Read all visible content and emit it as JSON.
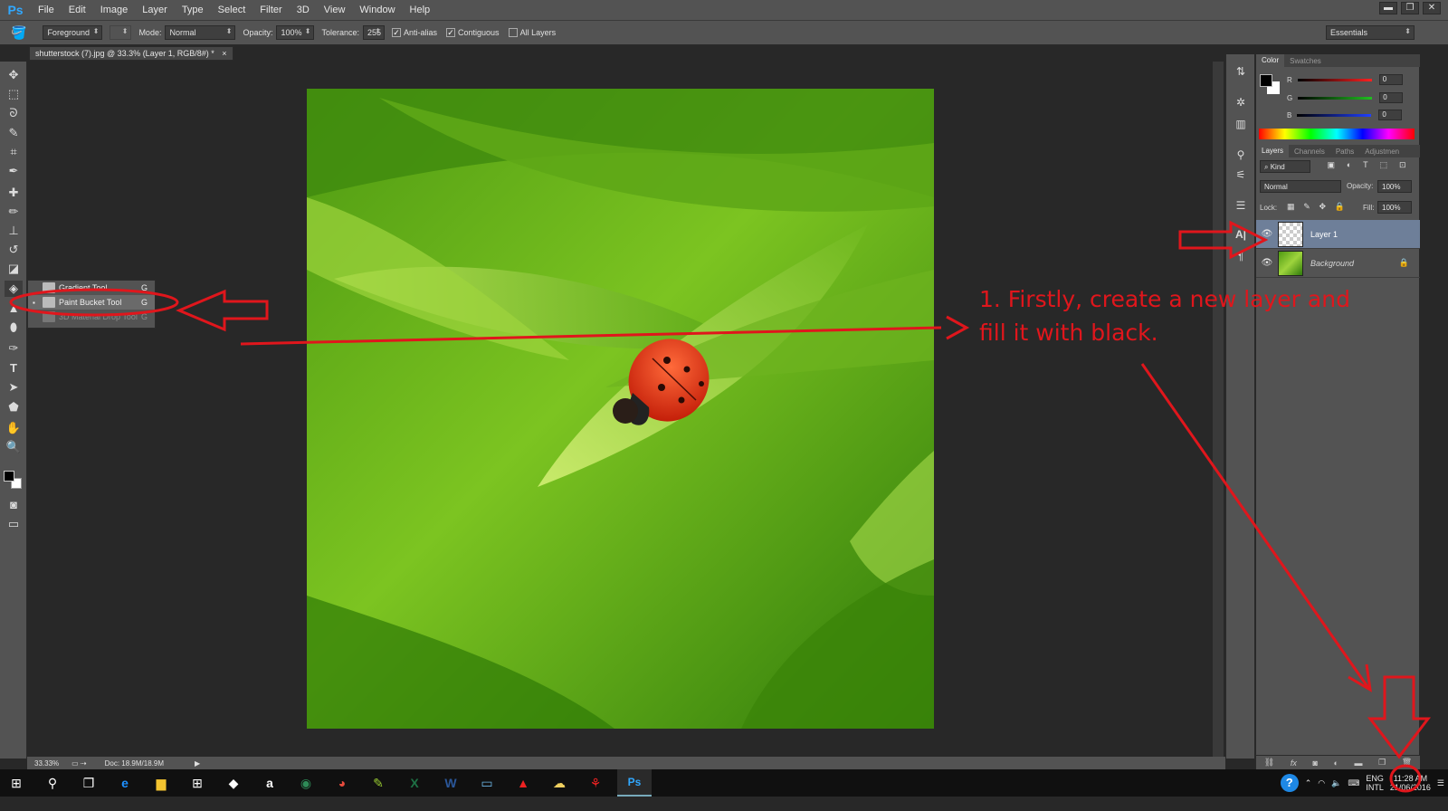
{
  "app": {
    "logo": "Ps"
  },
  "menu": [
    "File",
    "Edit",
    "Image",
    "Layer",
    "Type",
    "Select",
    "Filter",
    "3D",
    "View",
    "Window",
    "Help"
  ],
  "window_controls": [
    "▬",
    "❐",
    "✕"
  ],
  "options_bar": {
    "fill_source": "Foreground",
    "mode_label": "Mode:",
    "mode_value": "Normal",
    "opacity_label": "Opacity:",
    "opacity_value": "100%",
    "tolerance_label": "Tolerance:",
    "tolerance_value": "255",
    "antialias_label": "Anti-alias",
    "contiguous_label": "Contiguous",
    "all_layers_label": "All Layers",
    "workspace": "Essentials"
  },
  "document_tab": {
    "title": "shutterstock (7).jpg @ 33.3% (Layer 1, RGB/8#) *",
    "close": "×"
  },
  "tool_flyout": {
    "items": [
      {
        "label": "Gradient Tool",
        "key": "G"
      },
      {
        "label": "Paint Bucket Tool",
        "key": "G"
      },
      {
        "label": "3D Material Drop Tool",
        "key": "G"
      }
    ]
  },
  "color_panel": {
    "tabs": [
      "Color",
      "Swatches"
    ],
    "channels": [
      {
        "label": "R",
        "value": "0",
        "color": "#ff2020"
      },
      {
        "label": "G",
        "value": "0",
        "color": "#20c020"
      },
      {
        "label": "B",
        "value": "0",
        "color": "#2040ff"
      }
    ]
  },
  "layers_panel": {
    "tabs": [
      "Layers",
      "Channels",
      "Paths",
      "Adjustmen"
    ],
    "filter_label": "Kind",
    "blend_mode": "Normal",
    "opacity_label": "Opacity:",
    "opacity_value": "100%",
    "lock_label": "Lock:",
    "fill_label": "Fill:",
    "fill_value": "100%",
    "layers": [
      {
        "name": "Layer 1",
        "selected": true
      },
      {
        "name": "Background",
        "selected": false
      }
    ],
    "bottom_icons": [
      "link-icon",
      "fx-icon",
      "mask-icon",
      "adjustment-icon",
      "group-icon",
      "new-layer-icon",
      "trash-icon"
    ]
  },
  "status_bar": {
    "zoom": "33.33%",
    "doc": "Doc: 18.9M/18.9M"
  },
  "annotation": {
    "text": "1. Firstly, create a new layer and fill it with black.",
    "color": "#e0161c"
  },
  "taskbar": {
    "tray": {
      "lang": "ENG",
      "lang_sub": "INTL",
      "time": "11:28 AM",
      "date": "21/06/2016"
    },
    "apps": [
      "windows-icon",
      "search-icon",
      "task-view-icon",
      "edge-icon",
      "file-explorer-icon",
      "store-icon",
      "dropbox-icon",
      "amazon-icon",
      "tripadvisor-icon",
      "chrome-icon",
      "paint-icon",
      "excel-icon",
      "word-icon",
      "scanner-icon",
      "acrobat-icon",
      "onedrive-icon",
      "pdf-icon",
      "photoshop-icon"
    ]
  }
}
